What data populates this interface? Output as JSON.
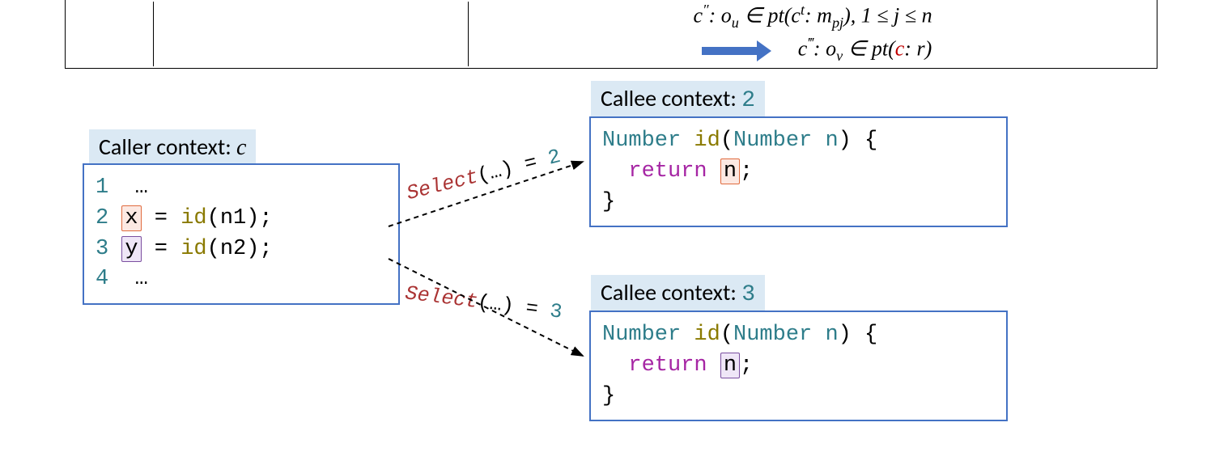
{
  "rule": {
    "premise": "c″: oᵤ ∈ pt(cᵗ: m_pj), 1 ≤ j ≤ n",
    "conclusion": "c‴: oᵥ ∈ pt(c: r)"
  },
  "caller": {
    "label_prefix": "Caller context: ",
    "label_var": "c",
    "lines": {
      "l1_num": "1",
      "l1_code": "…",
      "l2_num": "2",
      "l2_var": "x",
      "l2_rest_a": " = ",
      "l2_rest_fn": "id",
      "l2_rest_b": "(n1);",
      "l3_num": "3",
      "l3_var": "y",
      "l3_rest_a": " = ",
      "l3_rest_fn": "id",
      "l3_rest_b": "(n2);",
      "l4_num": "4",
      "l4_code": "…"
    }
  },
  "select": {
    "label1_a": "Select",
    "label1_b": "(…) = ",
    "label1_n": "2",
    "label2_a": "Select",
    "label2_b": "(…) = ",
    "label2_n": "3"
  },
  "callee1": {
    "label_prefix": "Callee context: ",
    "label_num": "2",
    "sig_type1": "Number",
    "sig_fn": "id",
    "sig_type2": "Number",
    "sig_param": "n",
    "sig_tail": ") {",
    "ret_kw": "return",
    "ret_var": "n",
    "ret_tail": ";",
    "close": "}"
  },
  "callee2": {
    "label_prefix": "Callee context: ",
    "label_num": "3",
    "sig_type1": "Number",
    "sig_fn": "id",
    "sig_type2": "Number",
    "sig_param": "n",
    "sig_tail": ") {",
    "ret_kw": "return",
    "ret_var": "n",
    "ret_tail": ";",
    "close": "}"
  }
}
